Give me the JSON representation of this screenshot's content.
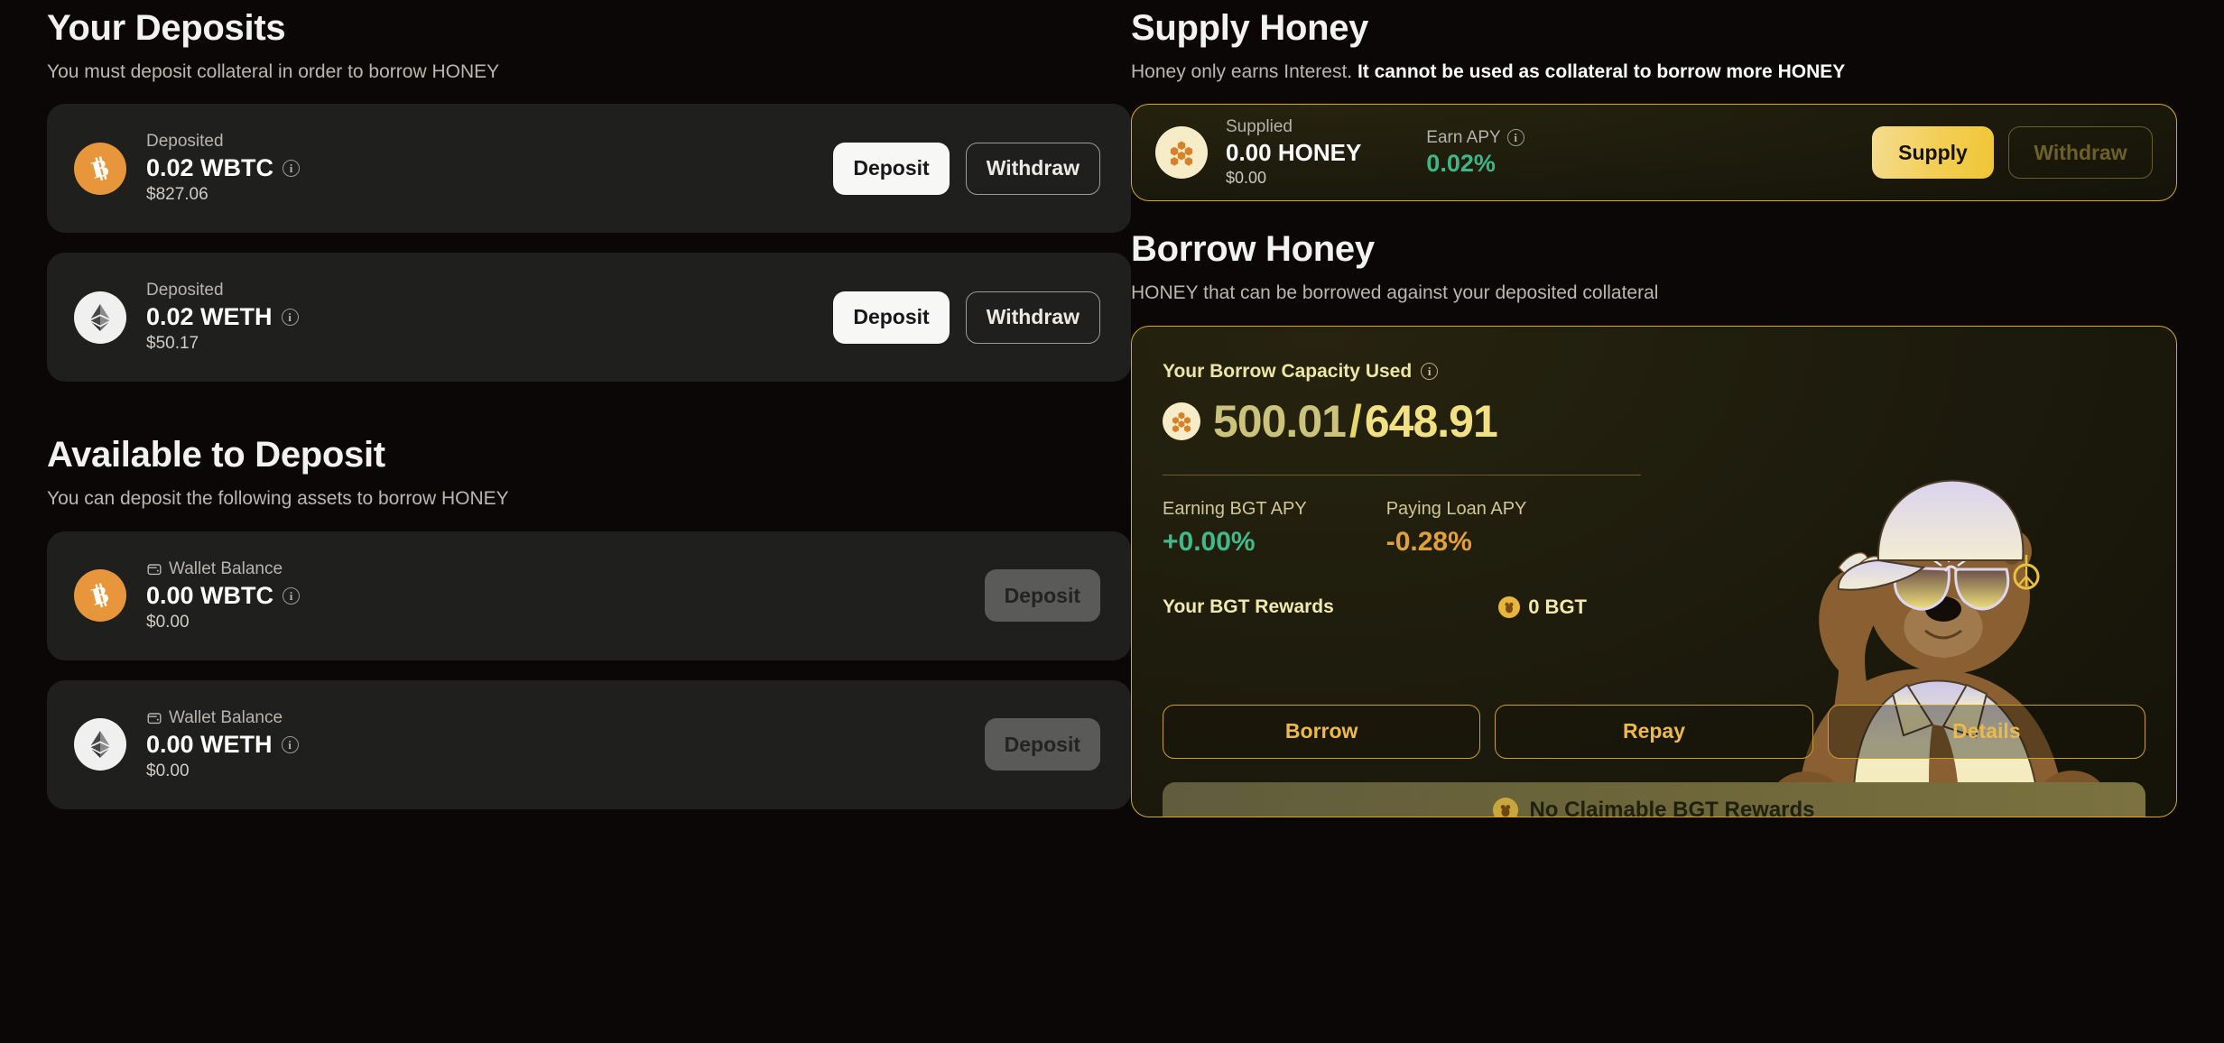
{
  "deposits": {
    "title": "Your Deposits",
    "subtitle": "You must deposit collateral in order to borrow HONEY",
    "rows": [
      {
        "icon": "bitcoin-icon",
        "label": "Deposited",
        "amount": "0.02 WBTC",
        "usd": "$827.06",
        "primary_label": "Deposit",
        "secondary_label": "Withdraw"
      },
      {
        "icon": "ethereum-icon",
        "label": "Deposited",
        "amount": "0.02 WETH",
        "usd": "$50.17",
        "primary_label": "Deposit",
        "secondary_label": "Withdraw"
      }
    ]
  },
  "available": {
    "title": "Available to Deposit",
    "subtitle": "You can deposit the following assets to borrow HONEY",
    "rows": [
      {
        "icon": "bitcoin-icon",
        "label": "Wallet Balance",
        "amount": "0.00 WBTC",
        "usd": "$0.00",
        "primary_label": "Deposit"
      },
      {
        "icon": "ethereum-icon",
        "label": "Wallet Balance",
        "amount": "0.00 WETH",
        "usd": "$0.00",
        "primary_label": "Deposit"
      }
    ]
  },
  "supply": {
    "title": "Supply Honey",
    "subtitle_plain": "Honey only earns Interest. ",
    "subtitle_bold": "It cannot be used as collateral to borrow more HONEY",
    "card": {
      "icon": "honey-icon",
      "label": "Supplied",
      "amount": "0.00 HONEY",
      "usd": "$0.00",
      "apy_label": "Earn APY",
      "apy_value": "0.02%",
      "supply_label": "Supply",
      "withdraw_label": "Withdraw"
    }
  },
  "borrow": {
    "title": "Borrow Honey",
    "subtitle": "HONEY that can be borrowed against your deposited collateral",
    "capacity_label": "Your Borrow Capacity Used",
    "capacity_used": "500.01",
    "capacity_separator": "/",
    "capacity_total": "648.91",
    "stats": [
      {
        "label": "Earning BGT APY",
        "value": "+0.00%"
      },
      {
        "label": "Paying Loan APY",
        "value": "-0.28%"
      }
    ],
    "rewards_label": "Your BGT Rewards",
    "rewards_value": "0 BGT",
    "actions": [
      "Borrow",
      "Repay",
      "Details"
    ],
    "claim_label": "No Claimable BGT Rewards"
  },
  "colors": {
    "page_bg": "#0a0706",
    "card_bg": "#1f1f1e",
    "gold_border": "#d9a81f",
    "gold_button": "#f3ce54",
    "green": "#3fb68a",
    "orange": "#e0a13a",
    "bitcoin": "#e8963c",
    "honey_cream": "#f6ecc7"
  }
}
